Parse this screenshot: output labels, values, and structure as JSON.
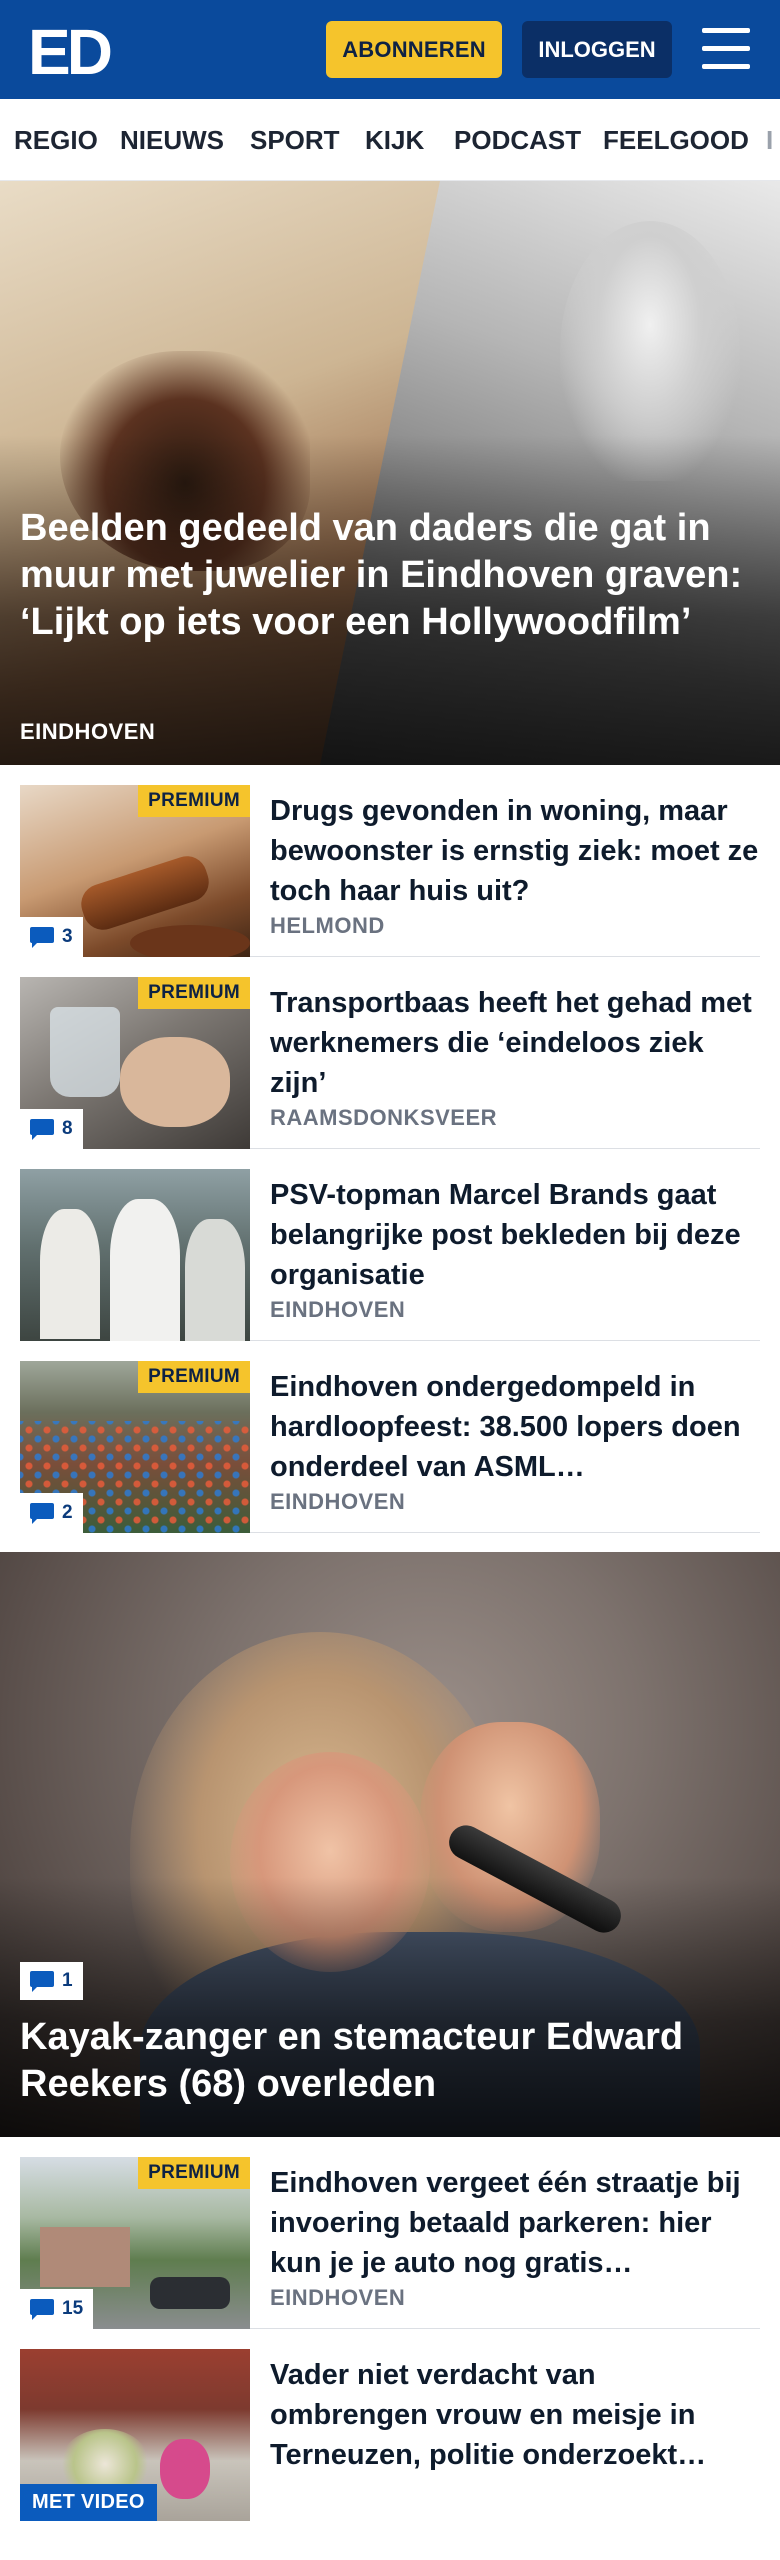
{
  "header": {
    "logo_text": "ED",
    "subscribe_label": "ABONNEREN",
    "login_label": "INLOGGEN",
    "menu_icon": "hamburger-menu-icon",
    "brand_color": "#0a4a9c",
    "accent_color": "#f5c42c"
  },
  "nav": {
    "items": [
      "REGIO",
      "NIEUWS",
      "SPORT",
      "KIJK",
      "PODCAST",
      "FEELGOOD",
      "I"
    ]
  },
  "hero": {
    "title": "Beelden gedeeld van daders die gat in muur met juwelier in Eindhoven graven: ‘Lijkt op iets voor een Hollywoodfilm’",
    "region": "EINDHOVEN"
  },
  "articles": [
    {
      "title": "Drugs gevonden in woning, maar bewoonster is ernstig ziek: moet ze toch haar huis uit?",
      "region": "HELMOND",
      "badge": "PREMIUM",
      "comments": "3"
    },
    {
      "title": "Transportbaas heeft het gehad met werknemers die ‘eindeloos ziek zijn’",
      "region": "RAAMSDONKSVEER",
      "badge": "PREMIUM",
      "comments": "8"
    },
    {
      "title": "PSV-topman Marcel Brands gaat belangrijke post bekleden bij deze organisatie",
      "region": "EINDHOVEN"
    },
    {
      "title": "Eindhoven ondergedompeld in hardloopfeest: 38.500 lopers doen onderdeel van ASML…",
      "region": "EINDHOVEN",
      "badge": "PREMIUM",
      "comments": "2"
    }
  ],
  "hero2": {
    "title": "Kayak-zanger en stemacteur Edward Reekers (68) overleden",
    "comments": "1"
  },
  "articles2": [
    {
      "title": "Eindhoven vergeet één straatje bij invoering betaald parkeren: hier kun je je auto nog gratis…",
      "region": "EINDHOVEN",
      "badge": "PREMIUM",
      "comments": "15"
    },
    {
      "title": "Vader niet verdacht van ombrengen vrouw en meisje in Terneuzen, politie onderzoekt…",
      "video_badge": "MET VIDEO"
    }
  ]
}
